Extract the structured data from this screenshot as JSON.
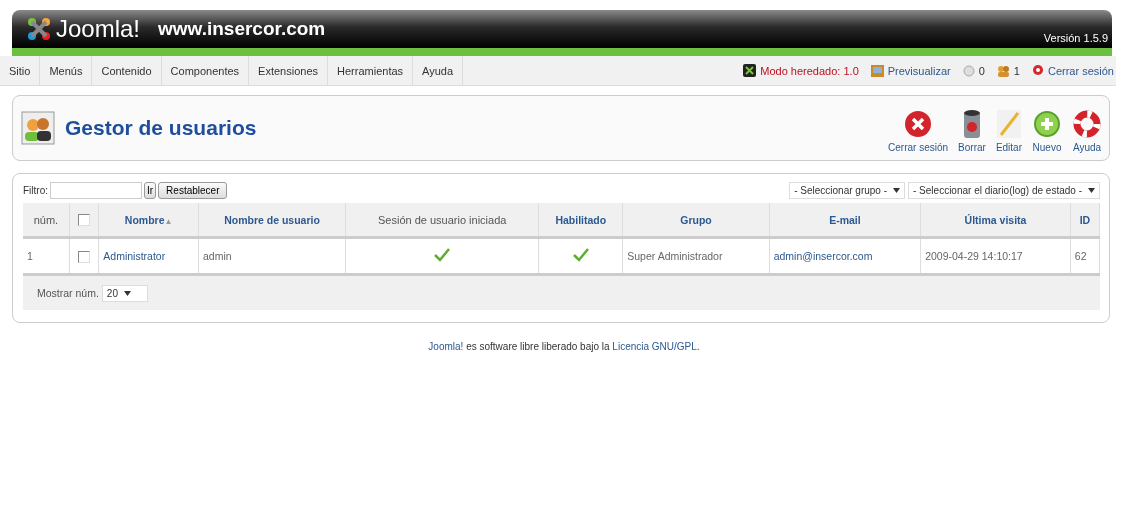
{
  "header": {
    "logo_text": "Joomla!",
    "site": "www.insercor.com",
    "version": "Versión 1.5.9"
  },
  "menu": [
    {
      "label": "Sitio"
    },
    {
      "label": "Menús"
    },
    {
      "label": "Contenido"
    },
    {
      "label": "Componentes"
    },
    {
      "label": "Extensiones"
    },
    {
      "label": "Herramientas"
    },
    {
      "label": "Ayuda"
    }
  ],
  "status": [
    {
      "kind": "legacy",
      "label": "Modo heredado: 1.0"
    },
    {
      "kind": "preview",
      "label": "Previsualizar"
    },
    {
      "kind": "messages",
      "label": "0"
    },
    {
      "kind": "users",
      "label": "1"
    },
    {
      "kind": "logout",
      "label": "Cerrar sesión"
    }
  ],
  "title": "Gestor de usuarios",
  "toolbar": [
    {
      "kind": "logout",
      "label": "Cerrar sesión"
    },
    {
      "kind": "delete",
      "label": "Borrar"
    },
    {
      "kind": "edit",
      "label": "Editar"
    },
    {
      "kind": "new",
      "label": "Nuevo"
    },
    {
      "kind": "help",
      "label": "Ayuda"
    }
  ],
  "filter": {
    "label": "Filtro:",
    "go": "Ir",
    "reset": "Restablecer"
  },
  "selects": [
    "- Seleccionar grupo -",
    "- Seleccionar el diario(log) de estado -"
  ],
  "table": {
    "columns": [
      {
        "label": "núm.",
        "link": false
      },
      {
        "kind": "checkbox",
        "checked": false
      },
      {
        "label": "Nombre",
        "link": true,
        "sort": "▲"
      },
      {
        "label": "Nombre de usuario",
        "link": true
      },
      {
        "label": "Sesión de usuario iniciada",
        "link": false
      },
      {
        "label": "Habilitado",
        "link": true
      },
      {
        "label": "Grupo",
        "link": true
      },
      {
        "label": "E-mail",
        "link": true
      },
      {
        "label": "Última visita",
        "link": true
      },
      {
        "label": "ID",
        "link": true
      }
    ],
    "rows": [
      {
        "num": "1",
        "checked": false,
        "name": "Administrator",
        "username": "admin",
        "logged_in": true,
        "enabled": true,
        "group": "Super Administrador",
        "email": "admin@insercor.com",
        "last_visit": "2009-04-29 14:10:17",
        "id": "62"
      }
    ]
  },
  "pagination": {
    "label": "Mostrar núm.",
    "value": "20"
  },
  "footer": {
    "pre": "Joomla!",
    "mid": " es software libre liberado bajo la ",
    "link": "Licencia GNU/GPL",
    "post": "."
  }
}
